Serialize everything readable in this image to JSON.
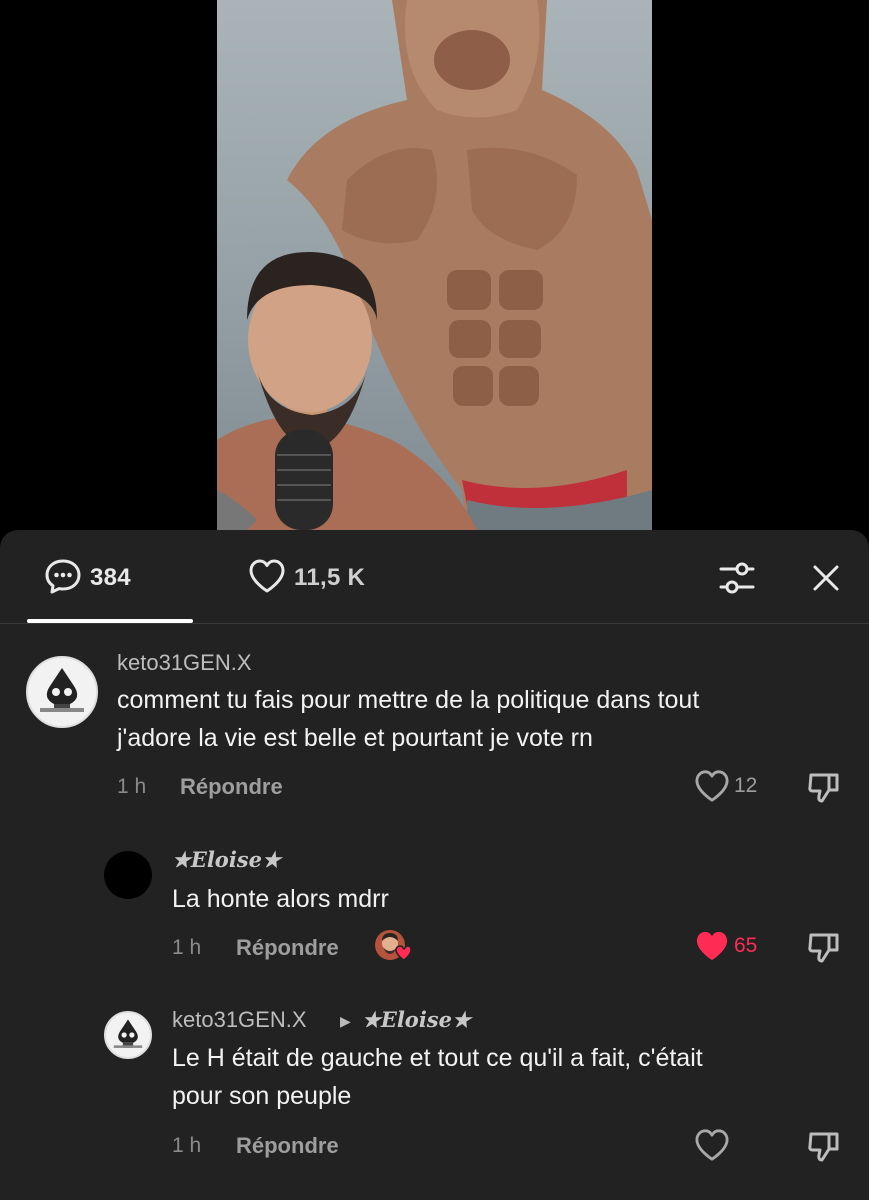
{
  "tabs": {
    "comments_count": "384",
    "likes_count": "11,5 K"
  },
  "icons": {
    "comments": "chat-bubble-icon",
    "likes": "heart-outline-icon",
    "filter": "sliders-icon",
    "close": "close-icon",
    "dislike": "thumbs-down-icon",
    "liked": "heart-filled-icon"
  },
  "colors": {
    "sheet_bg": "#222222",
    "accent_red": "#fe2c55",
    "tab_underline": "#ffffff"
  },
  "comments": [
    {
      "username": "keto31GEN.X",
      "text_line1": "comment tu fais pour mettre de la politique dans tout",
      "text_line2": "j'adore la vie est belle et pourtant je vote rn",
      "time": "1 h",
      "reply_label": "Répondre",
      "likes": "12",
      "liked": false
    },
    {
      "username": "★Eloise★",
      "text_line1": "La honte alors mdrr",
      "time": "1 h",
      "reply_label": "Répondre",
      "likes": "65",
      "liked": true,
      "creator_liked": true
    },
    {
      "username": "keto31GEN.X",
      "reply_to": "★Eloise★",
      "text_line1": "Le H était de gauche et tout ce qu'il a fait, c'était",
      "text_line2": "pour son peuple",
      "time": "1 h",
      "reply_label": "Répondre",
      "likes": "",
      "liked": false
    }
  ]
}
